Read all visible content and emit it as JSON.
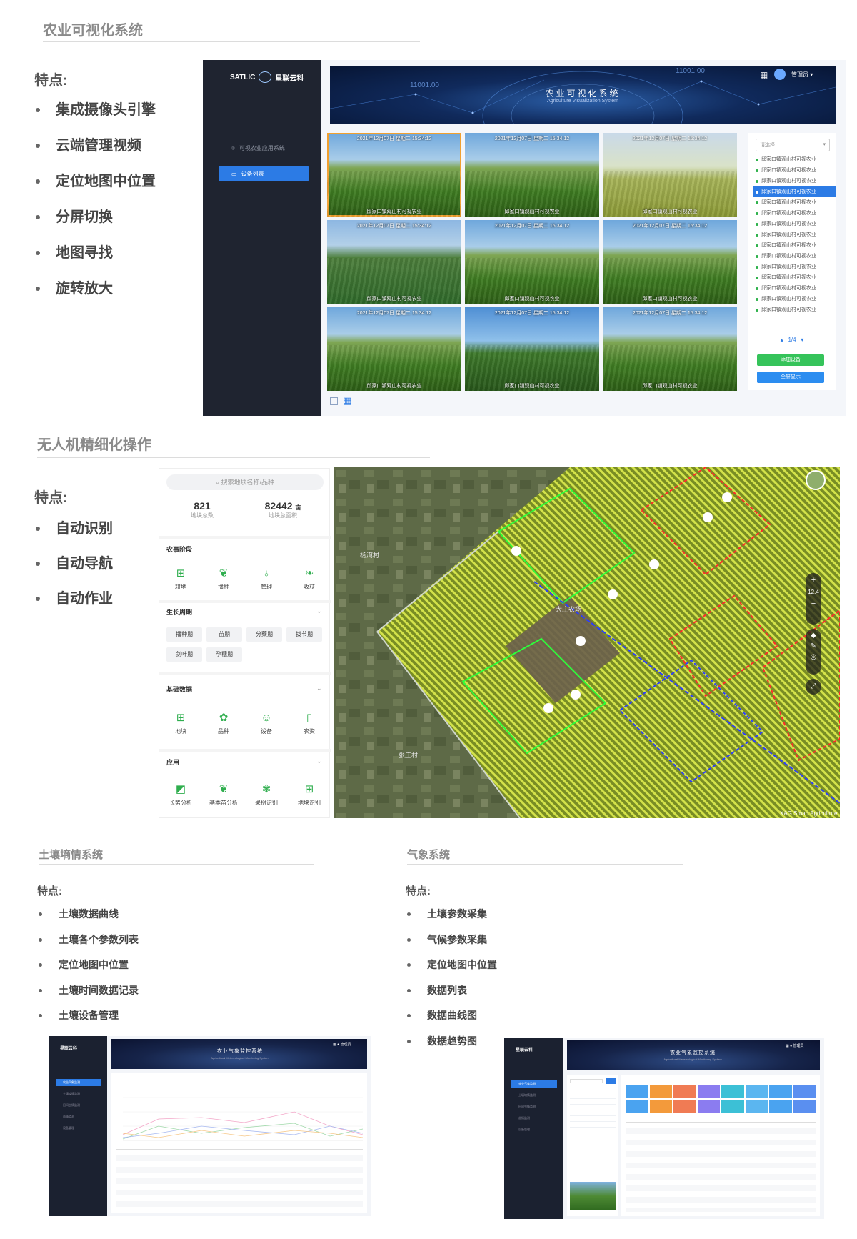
{
  "section1": {
    "title": "农业可视化系统",
    "features_title": "特点:",
    "features": [
      "集成摄像头引擎",
      "云端管理视频",
      "定位地图中位置",
      "分屏切换",
      "地图寻找",
      "旋转放大"
    ],
    "app": {
      "logo_text": "SATLIC",
      "logo_brand": "星联云科",
      "nav_items": [
        "可视农业应用系统",
        "设备列表"
      ],
      "banner_code_left": "11001.00",
      "banner_code_right": "11001.00",
      "banner_title": "农业可视化系统",
      "banner_subtitle": "Agriculture Visualization System",
      "user_label": "管理员",
      "cameras": [
        {
          "timestamp": "2021年12月07日 星期二 15:34:12",
          "label": "邱家口镇观山村可视农业"
        },
        {
          "timestamp": "2021年12月07日 星期二 15:34:12",
          "label": "邱家口镇观山村可视农业"
        },
        {
          "timestamp": "2021年12月07日 星期二 15:34:12",
          "label": "邱家口镇观山村可视农业"
        },
        {
          "timestamp": "2021年12月07日 星期二 15:34:12",
          "label": "邱家口镇观山村可视农业"
        },
        {
          "timestamp": "2021年12月07日 星期二 15:34:12",
          "label": "邱家口镇观山村可视农业"
        },
        {
          "timestamp": "2021年12月07日 星期二 15:34:12",
          "label": "邱家口镇观山村可视农业"
        },
        {
          "timestamp": "2021年12月07日 星期二 15:34:12",
          "label": "邱家口镇观山村可视农业"
        },
        {
          "timestamp": "2021年12月07日 星期二 15:34:12",
          "label": "邱家口镇观山村可视农业"
        },
        {
          "timestamp": "2021年12月07日 星期二 15:34:12",
          "label": "邱家口镇观山村可视农业"
        }
      ],
      "device_select_placeholder": "请选择",
      "devices": [
        "邱家口镇观山村可视农业",
        "邱家口镇观山村可视农业",
        "邱家口镇观山村可视农业",
        "邱家口镇观山村可视农业",
        "邱家口镇观山村可视农业",
        "邱家口镇观山村可视农业",
        "邱家口镇观山村可视农业",
        "邱家口镇观山村可视农业",
        "邱家口镇观山村可视农业",
        "邱家口镇观山村可视农业",
        "邱家口镇观山村可视农业",
        "邱家口镇观山村可视农业",
        "邱家口镇观山村可视农业",
        "邱家口镇观山村可视农业",
        "邱家口镇观山村可视农业"
      ],
      "selected_device_index": 3,
      "pagination": "1/4",
      "add_device_label": "添加设备",
      "fullscreen_label": "全屏显示"
    }
  },
  "section2": {
    "title": "无人机精细化操作",
    "features_title": "特点:",
    "features": [
      "自动识别",
      "自动导航",
      "自动作业"
    ],
    "panel": {
      "search_placeholder": "搜索地块名称/品种",
      "stats": [
        {
          "value": "821",
          "unit": "",
          "label": "地块总数"
        },
        {
          "value": "82442",
          "unit": "亩",
          "label": "地块总面积"
        }
      ],
      "groups": [
        {
          "title": "农事阶段",
          "items": [
            "耕地",
            "播种",
            "管理",
            "收获"
          ]
        },
        {
          "title": "生长周期",
          "chips": [
            "播种期",
            "苗期",
            "分蘖期",
            "拔节期",
            "剑叶期",
            "孕穗期"
          ]
        },
        {
          "title": "基础数据",
          "items": [
            "地块",
            "品种",
            "设备",
            "农资"
          ]
        },
        {
          "title": "应用",
          "items": [
            "长势分析",
            "基本苗分析",
            "果树识别",
            "地块识别"
          ]
        }
      ]
    },
    "map": {
      "zoom_level": "12.4",
      "village_labels": [
        "杨湾村",
        "大庄农场",
        "张庄村"
      ],
      "watermark": "XAG Smart Agriculture"
    }
  },
  "section3": {
    "title": "土壤墒情系统",
    "features_title": "特点:",
    "features": [
      "土壤数据曲线",
      "土壤各个参数列表",
      "定位地图中位置",
      "土壤时间数据记录",
      "土壤设备管理"
    ],
    "mini": {
      "logo": "星联云科",
      "banner_title": "农业气象监控系统",
      "banner_sub": "Agricultural Meteorological Monitoring System",
      "user": "管理员",
      "nav": [
        "农业气象监测",
        "土壤墒情监测",
        "田间虫情监测",
        "苗情监测",
        "设备管理"
      ]
    }
  },
  "section4": {
    "title": "气象系统",
    "features_title": "特点:",
    "features": [
      "土壤参数采集",
      "气候参数采集",
      "定位地图中位置",
      "数据列表",
      "数据曲线图",
      "数据趋势图"
    ],
    "mini": {
      "logo": "星联云科",
      "banner_title": "农业气象监控系统",
      "banner_sub": "Agricultural Meteorological Monitoring System",
      "user": "管理员",
      "nav": [
        "农业气象监测",
        "土壤墒情监测",
        "田间虫情监测",
        "苗情监测",
        "设备管理"
      ]
    }
  }
}
